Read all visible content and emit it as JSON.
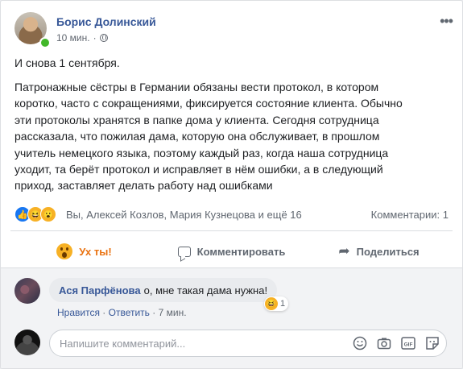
{
  "post": {
    "author": "Борис Долинский",
    "time": "10 мин.",
    "separator": "·",
    "first_line": "И снова 1 сентября.",
    "body": "Патронажные сёстры в Германии обязаны вести протокол, в котором\nкоротко, часто с сокращениями, фиксируется состояние клиента. Обычно\nэти протоколы хранятся в папке дома у клиента. Сегодня сотрудница\nрассказала, что пожилая дама, которую она обслуживает, в прошлом\nучитель немецкого языка, поэтому каждый раз, когда наша сотрудница\nуходит, та берёт протокол и исправляет в нём ошибки, а в следующий\nприход, заставляет делать работу над ошибками"
  },
  "reactions": {
    "icons": [
      "like-icon",
      "haha-icon",
      "wow-icon"
    ],
    "names": "Вы, Алексей Козлов, Мария Кузнецова и ещё 16",
    "comments_count": "Комментарии: 1"
  },
  "actions": {
    "reaction_label": "Ух ты!",
    "comment_label": "Комментировать",
    "share_label": "Поделиться"
  },
  "comment": {
    "author": "Ася Парфёнова",
    "text": "о, мне такая дама нужна!",
    "reaction_count": "1",
    "like_label": "Нравится",
    "separator": "·",
    "reply_label": "Ответить",
    "time": "· 7 мин."
  },
  "composer": {
    "placeholder": "Напишите комментарий..."
  },
  "colors": {
    "link": "#385898",
    "wow_accent": "#e9710f",
    "like_blue": "#1877f2",
    "emoji_yellow": "#f7b125",
    "online": "#42b72a"
  }
}
